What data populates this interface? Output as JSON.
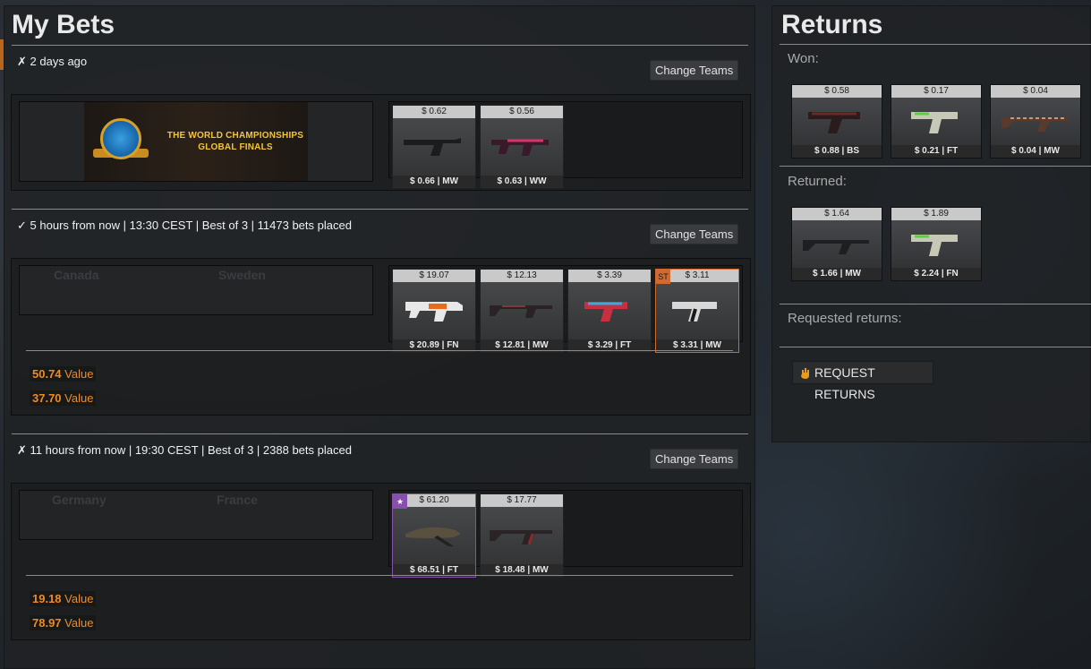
{
  "bets": {
    "title": "My Bets",
    "change_teams_label": "Change Teams",
    "matches": [
      {
        "status_icon": "✗",
        "meta": "2 days ago",
        "banner_text_line1": "THE WORLD CHAMPIONSHIPS",
        "banner_text_line2": "GLOBAL FINALS",
        "items": [
          {
            "top": "$ 0.62",
            "bottom": "$ 0.66 | MW"
          },
          {
            "top": "$ 0.56",
            "bottom": "$ 0.63 | WW"
          }
        ]
      },
      {
        "status_icon": "✓",
        "meta": "5 hours from now | 13:30 CEST | Best of 3 | 11473 bets placed",
        "team_a": "Canada",
        "team_b": "Sweden",
        "items": [
          {
            "top": "$ 19.07",
            "bottom": "$ 20.89 | FN"
          },
          {
            "top": "$ 12.13",
            "bottom": "$ 12.81 | MW"
          },
          {
            "top": "$ 3.39",
            "bottom": "$ 3.29 | FT"
          },
          {
            "top": "$ 3.11",
            "bottom": "$ 3.31 | MW",
            "tag": "ST"
          }
        ],
        "values": [
          {
            "amount": "50.74",
            "label": "Value"
          },
          {
            "amount": "37.70",
            "label": "Value"
          }
        ]
      },
      {
        "status_icon": "✗",
        "meta": "11 hours from now | 19:30 CEST | Best of 3 | 2388 bets placed",
        "team_a": "Germany",
        "team_b": "France",
        "items": [
          {
            "top": "$ 61.20",
            "bottom": "$ 68.51 | FT",
            "tag": "★"
          },
          {
            "top": "$ 17.77",
            "bottom": "$ 18.48 | MW"
          }
        ],
        "values": [
          {
            "amount": "19.18",
            "label": "Value"
          },
          {
            "amount": "78.97",
            "label": "Value"
          }
        ]
      }
    ]
  },
  "returns": {
    "title": "Returns",
    "won_label": "Won:",
    "won_items": [
      {
        "top": "$ 0.58",
        "bottom": "$ 0.88 | BS"
      },
      {
        "top": "$ 0.17",
        "bottom": "$ 0.21 | FT"
      },
      {
        "top": "$ 0.04",
        "bottom": "$ 0.04 | MW"
      }
    ],
    "returned_label": "Returned:",
    "returned_items": [
      {
        "top": "$ 1.64",
        "bottom": "$ 1.66 | MW"
      },
      {
        "top": "$ 1.89",
        "bottom": "$ 2.24 | FN"
      }
    ],
    "requested_label": "Requested returns:",
    "request_button": "REQUEST RETURNS"
  },
  "colors": {
    "accent_orange": "#f08a24",
    "stattrak": "#cf6a32",
    "knife_purple": "#8650ac"
  }
}
